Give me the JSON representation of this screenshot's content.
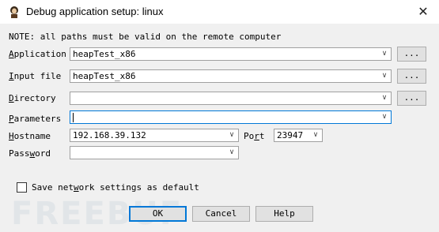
{
  "window": {
    "title": "Debug application setup: linux",
    "close_icon": "close-icon",
    "app_icon": "ida-debugger-icon"
  },
  "note": "NOTE: all paths must be valid on the remote computer",
  "fields": {
    "application": {
      "label_hotkey": "A",
      "label_rest": "pplication",
      "value": "heapTest_x86",
      "browse_label": "..."
    },
    "input_file": {
      "label_hotkey": "I",
      "label_rest": "nput file",
      "value": "heapTest_x86",
      "browse_label": "..."
    },
    "directory": {
      "label_hotkey": "D",
      "label_rest": "irectory",
      "value": "",
      "browse_label": "..."
    },
    "parameters": {
      "label_hotkey": "P",
      "label_rest": "arameters",
      "value": ""
    },
    "hostname": {
      "label_hotkey": "H",
      "label_rest": "ostname",
      "value": "192.168.39.132"
    },
    "port": {
      "label_pre": "Po",
      "label_hotkey": "r",
      "label_rest": "t",
      "value": "23947"
    },
    "password": {
      "label_pre": "Pass",
      "label_hotkey": "w",
      "label_rest": "ord",
      "value": ""
    }
  },
  "save_settings": {
    "label_pre": "Save net",
    "label_hotkey": "w",
    "label_rest": "ork settings as default",
    "checked": false
  },
  "buttons": {
    "ok": "OK",
    "cancel": "Cancel",
    "help": "Help"
  },
  "watermark": "FREEBUF"
}
